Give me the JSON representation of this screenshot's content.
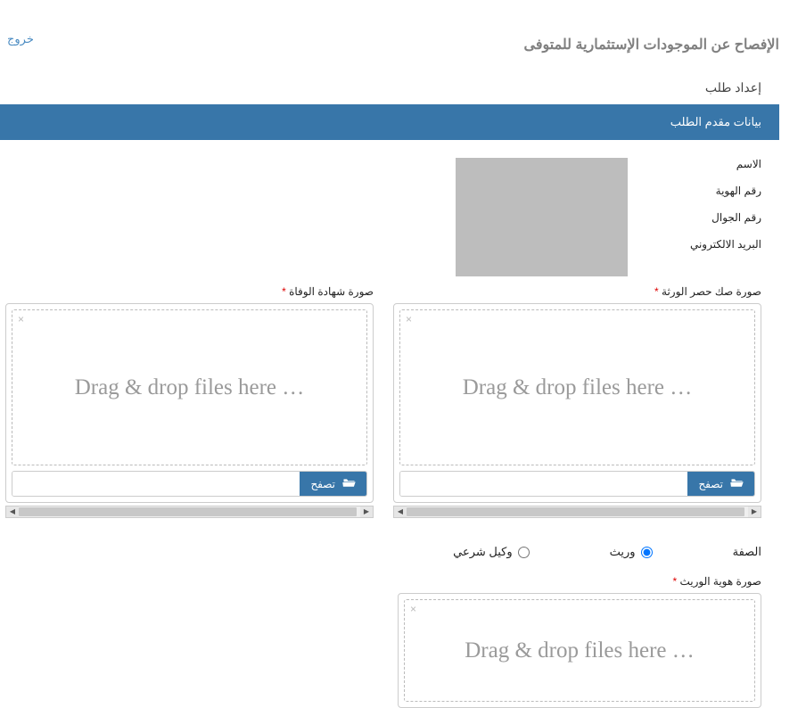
{
  "logout": "خروج",
  "page_title": "الإفصاح عن الموجودات الإستثمارية للمتوفى",
  "section_prepare": "إعداد طلب",
  "applicant_header": "بيانات مقدم الطلب",
  "labels": {
    "name": "الاسم",
    "id_number": "رقم الهوية",
    "mobile": "رقم الجوال",
    "email": "البريد الالكتروني"
  },
  "fields": {
    "heirs_deed": "صورة صك حصر الورثة",
    "death_cert": "صورة شهادة الوفاة",
    "capacity": "الصفة",
    "heir_id": "صورة هوية الوريث"
  },
  "radio": {
    "heir": "وريث",
    "legal_agent": "وكيل شرعي"
  },
  "dropzone_text": "Drag & drop files here …",
  "browse_label": "تصفح",
  "required_mark": "*"
}
